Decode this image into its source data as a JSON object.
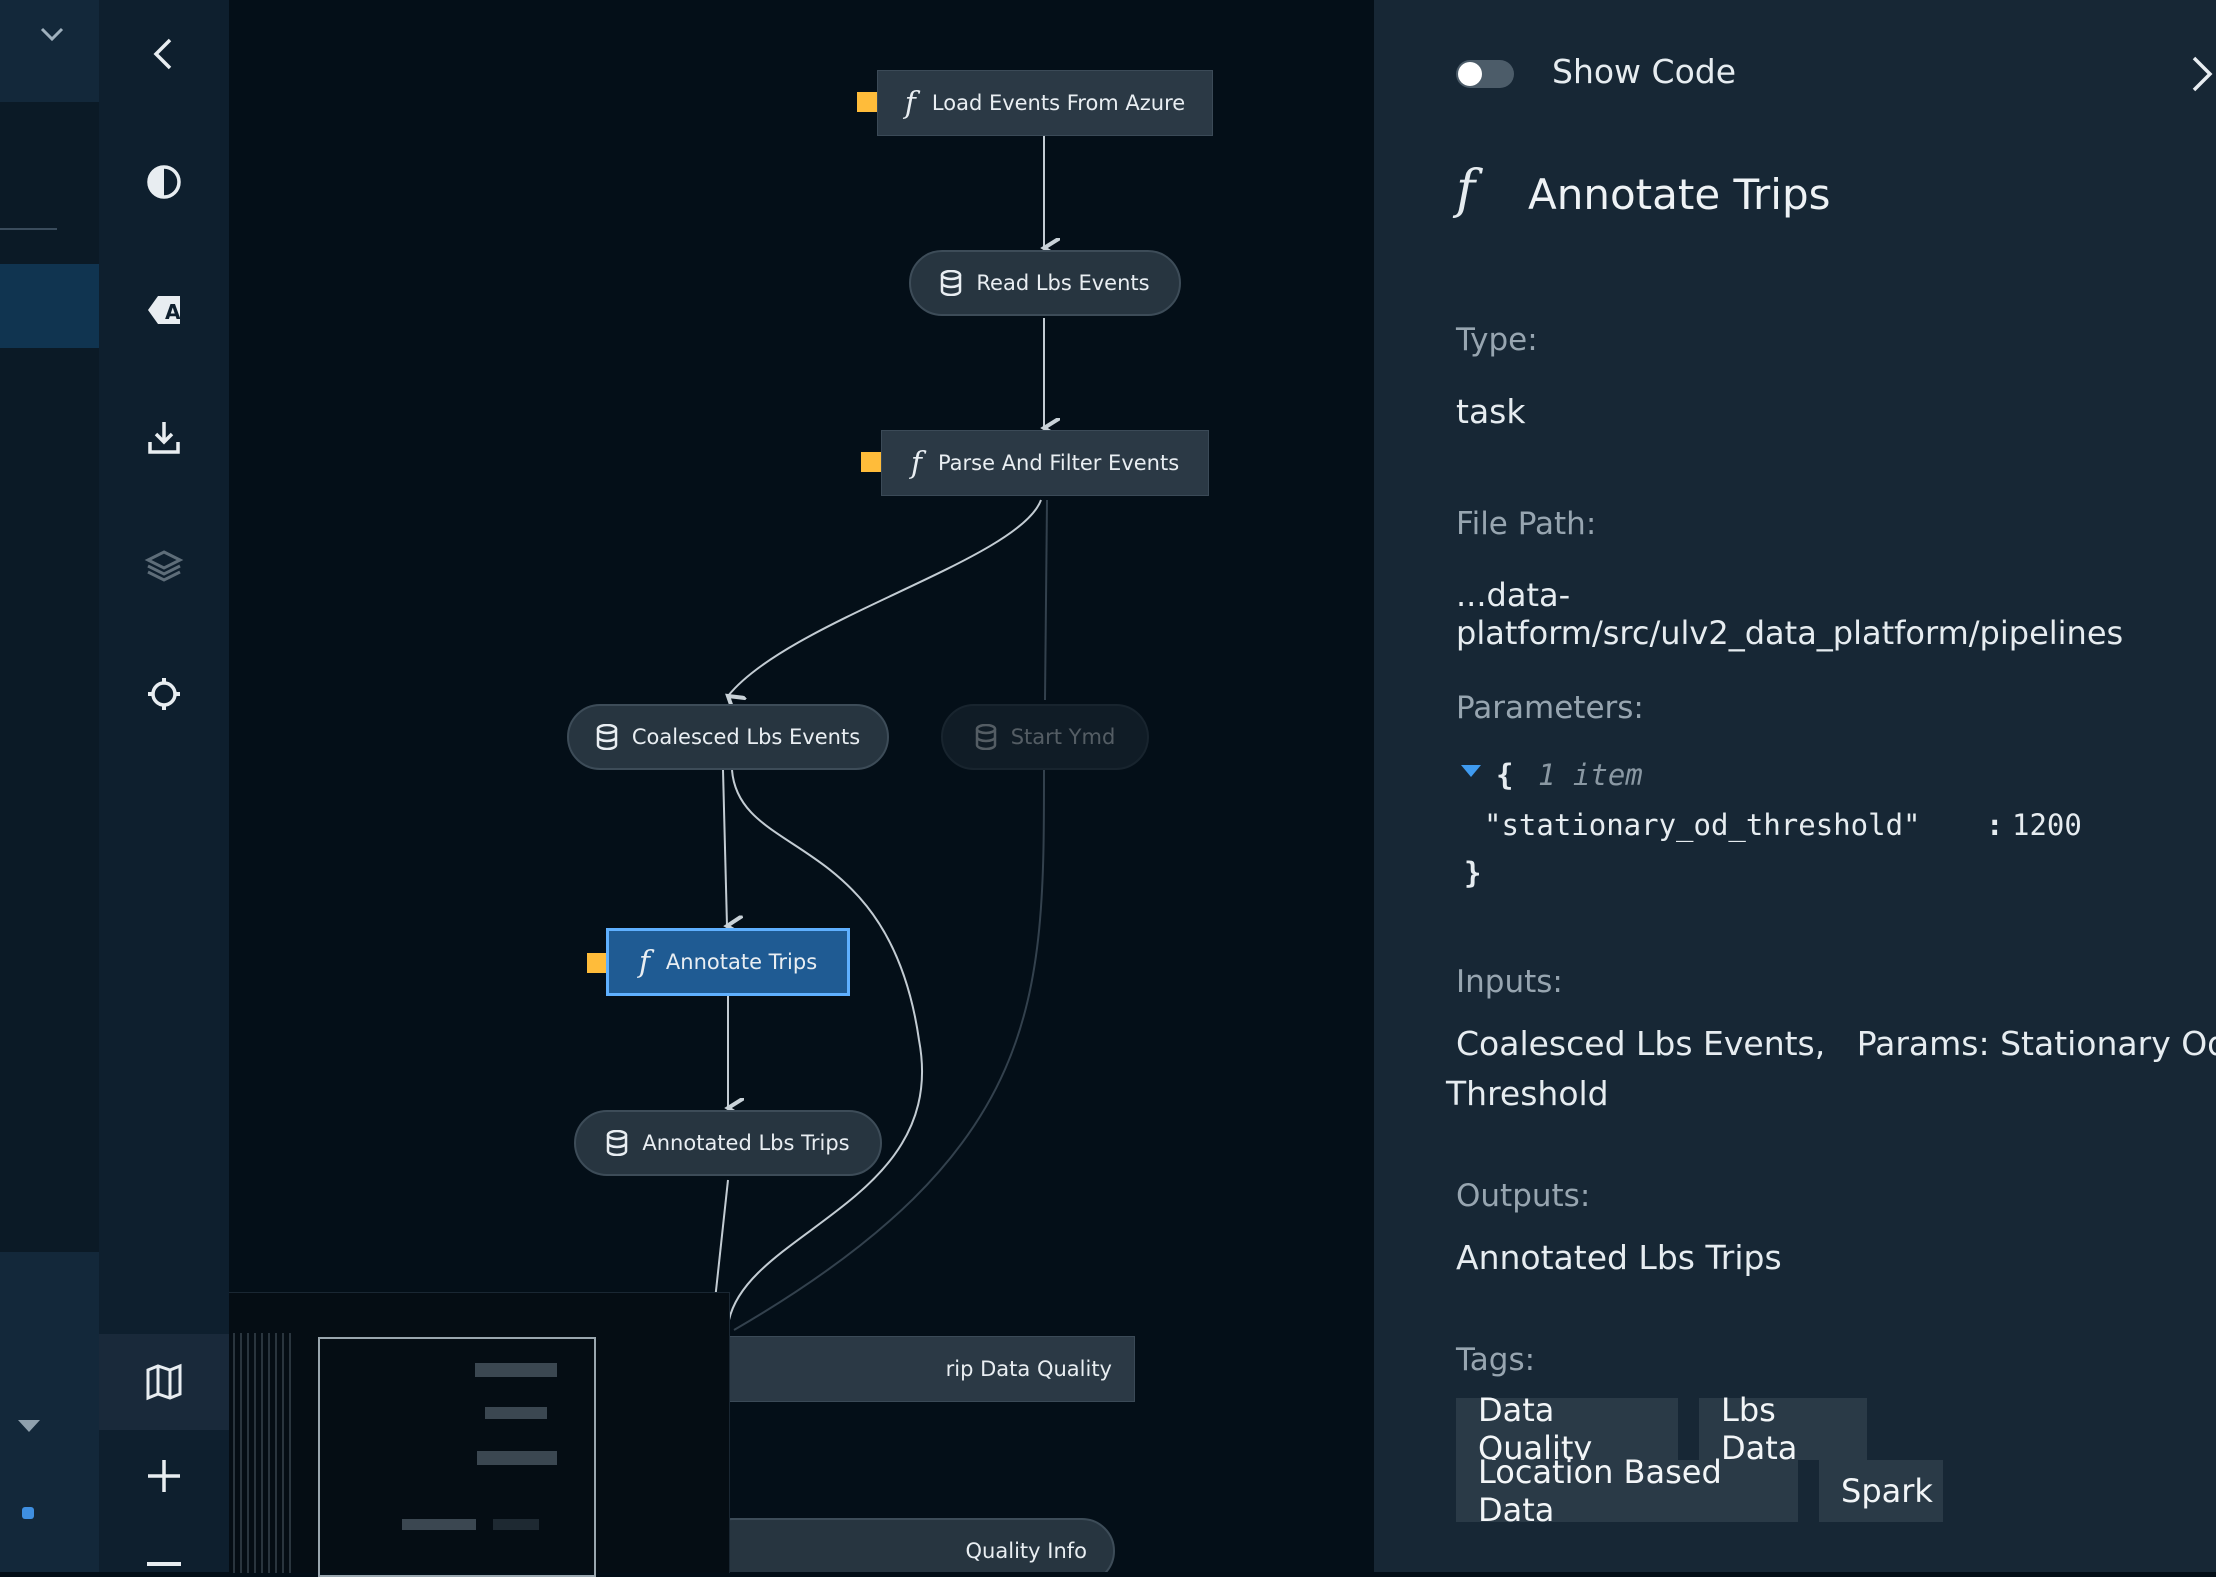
{
  "flow": {
    "nodes": {
      "load_events": "Load Events From Azure",
      "read_lbs": "Read Lbs Events",
      "parse_filter": "Parse And Filter Events",
      "coalesced": "Coalesced Lbs Events",
      "start_ymd": "Start Ymd",
      "annotate_trips": "Annotate Trips",
      "annotated_lbs": "Annotated Lbs Trips",
      "trip_dq": "rip Data Quality",
      "quality_info": "Quality Info"
    }
  },
  "panel": {
    "show_code_label": "Show Code",
    "title": "Annotate Trips",
    "type_label": "Type:",
    "type_value": "task",
    "filepath_label": "File Path:",
    "filepath_value": "...data-platform/src/ulv2_data_platform/pipelines",
    "parameters_label": "Parameters:",
    "params_open": "{",
    "params_count": "1 item",
    "param_key": "\"stationary_od_threshold\"",
    "param_sep": ":",
    "param_value": "1200",
    "params_close": "}",
    "inputs_label": "Inputs:",
    "inputs_line1": "Coalesced Lbs Events,   Params: Stationary Od",
    "inputs_line2": "Threshold",
    "outputs_label": "Outputs:",
    "outputs_value": "Annotated Lbs Trips",
    "tags_label": "Tags:",
    "tags": [
      "Data Quality",
      "Lbs Data",
      "Location Based Data",
      "Spark"
    ]
  },
  "colors": {
    "accent": "#5fb0ff",
    "param_marker": "#ffbc3a",
    "selected_node": "#1f5b93"
  }
}
